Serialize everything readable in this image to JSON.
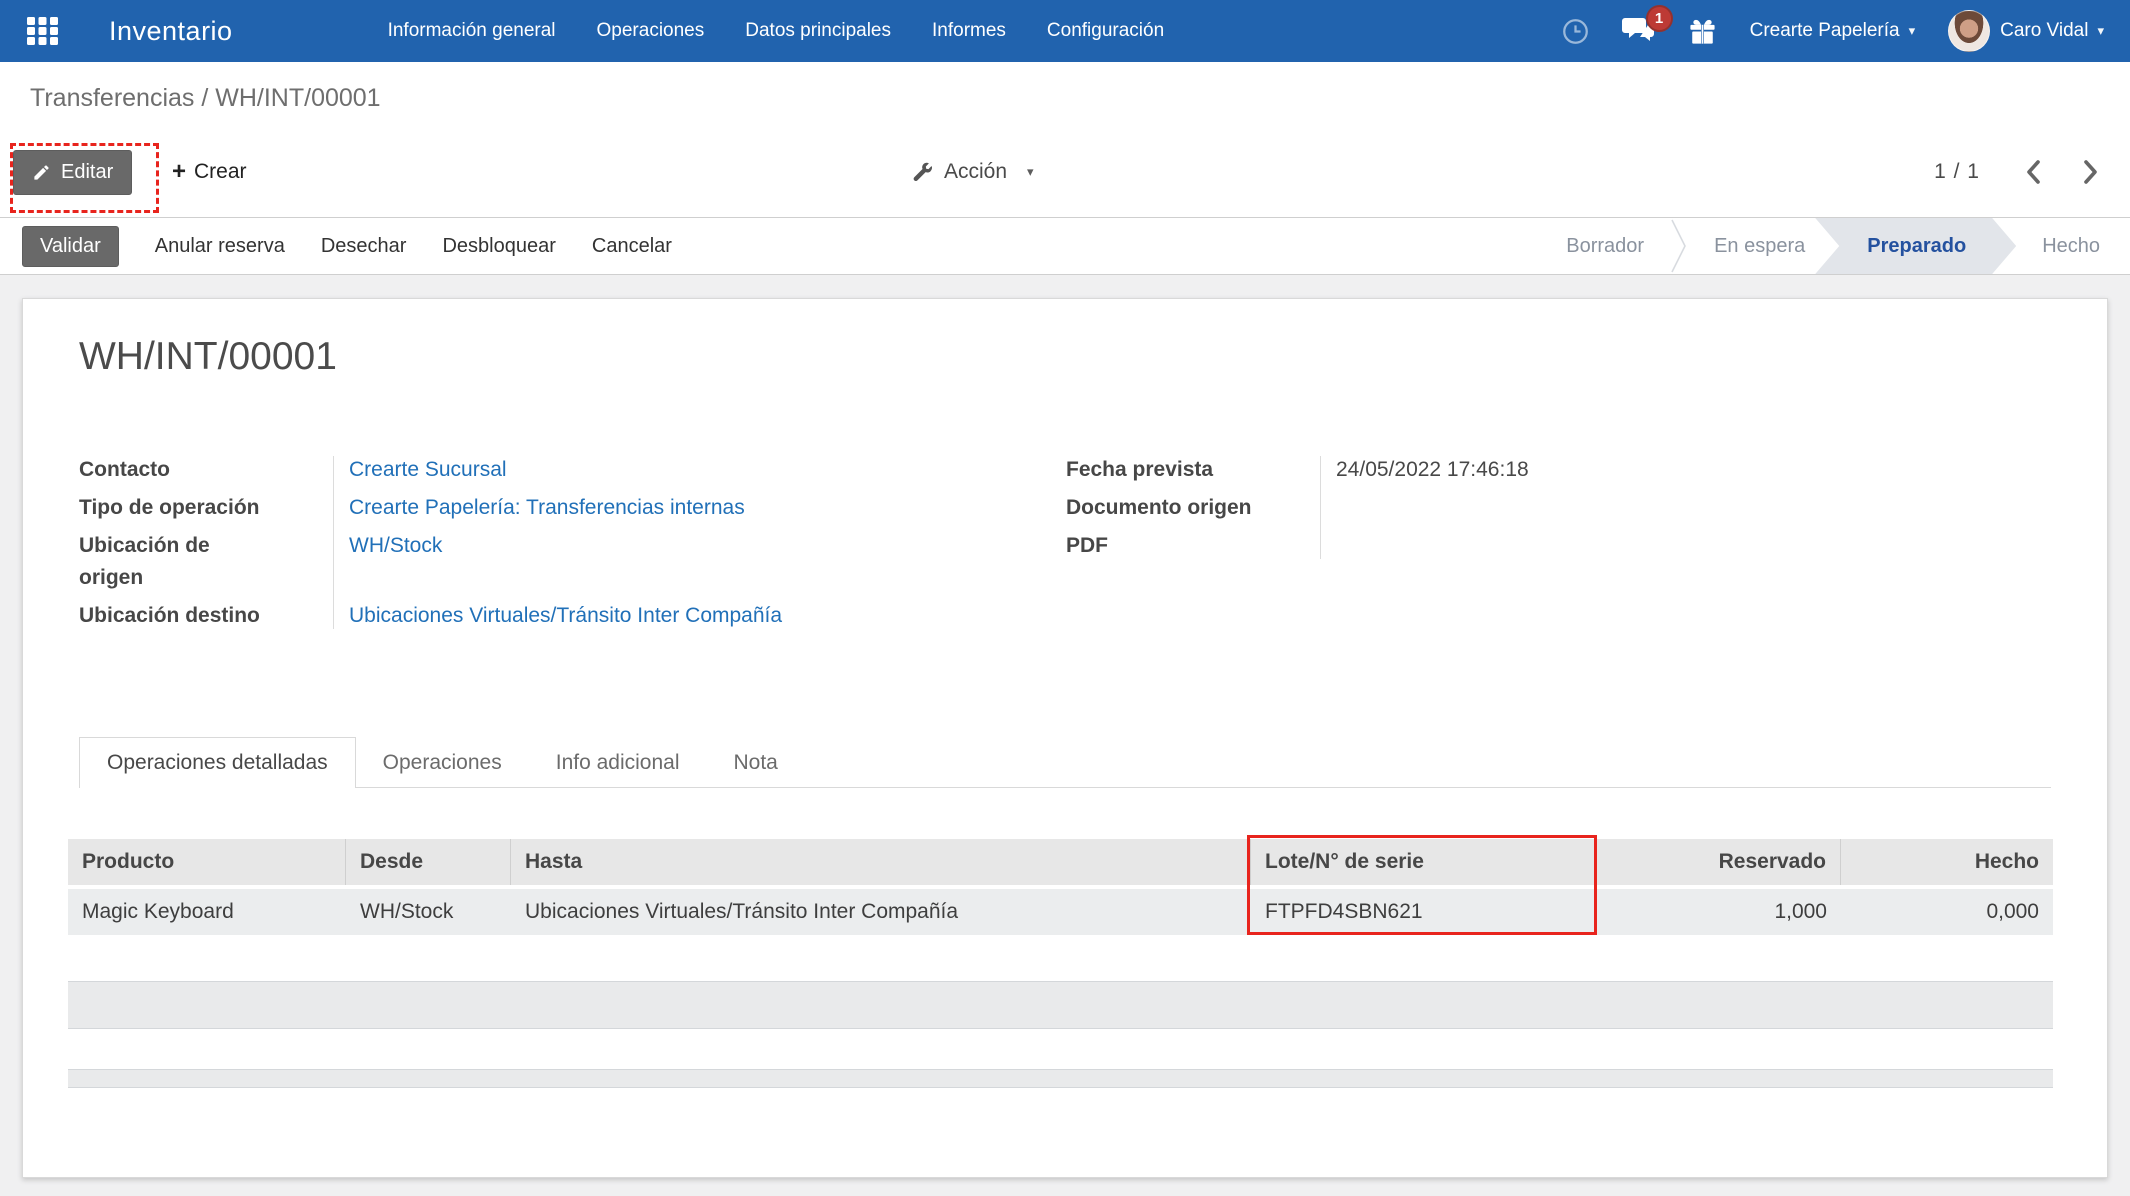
{
  "navbar": {
    "app_title": "Inventario",
    "menus": [
      "Información general",
      "Operaciones",
      "Datos principales",
      "Informes",
      "Configuración"
    ],
    "badge_count": "1",
    "company": "Crearte Papelería",
    "user": "Caro Vidal"
  },
  "breadcrumb": "Transferencias / WH/INT/00001",
  "actions": {
    "edit": "Editar",
    "create": "Crear",
    "action_menu": "Acción",
    "pager": "1 / 1"
  },
  "statusbar": {
    "buttons": [
      "Validar",
      "Anular reserva",
      "Desechar",
      "Desbloquear",
      "Cancelar"
    ],
    "stages": [
      "Borrador",
      "En espera",
      "Preparado",
      "Hecho"
    ],
    "active_stage": "Preparado"
  },
  "form": {
    "title": "WH/INT/00001",
    "left_fields": [
      {
        "label": "Contacto",
        "value": "Crearte Sucursal"
      },
      {
        "label": "Tipo de operación",
        "value": "Crearte Papelería: Transferencias internas"
      },
      {
        "label": "Ubicación de origen",
        "value": "WH/Stock"
      },
      {
        "label": "Ubicación destino",
        "value": "Ubicaciones Virtuales/Tránsito Inter Compañía"
      }
    ],
    "right_fields": [
      {
        "label": "Fecha prevista",
        "value": "24/05/2022 17:46:18"
      },
      {
        "label": "Documento origen",
        "value": ""
      },
      {
        "label": "PDF",
        "value": ""
      }
    ],
    "tabs": [
      "Operaciones detalladas",
      "Operaciones",
      "Info adicional",
      "Nota"
    ],
    "active_tab": "Operaciones detalladas"
  },
  "table": {
    "headers": [
      "Producto",
      "Desde",
      "Hasta",
      "Lote/N° de serie",
      "Reservado",
      "Hecho"
    ],
    "rows": [
      [
        "Magic Keyboard",
        "WH/Stock",
        "Ubicaciones Virtuales/Tránsito Inter Compañía",
        "FTPFD4SBN621",
        "1,000",
        "0,000"
      ]
    ]
  },
  "icons": {
    "apps_grid": "3x3-dots-grid",
    "clock": "activity-clock",
    "chat": "speech-bubbles",
    "gift": "gift-box",
    "caret": "▾",
    "pencil": "pencil",
    "plus": "+",
    "wrench": "wrench",
    "chevron_left": "‹",
    "chevron_right": "›"
  },
  "colors": {
    "navbar_bg": "#2163ae",
    "badge_red": "#bd3a35",
    "annotation_red": "#e8241d",
    "link_blue": "#2170b8",
    "active_stage_text": "#24519f",
    "active_stage_bg": "#e2e5ea",
    "dark_button": "#696969",
    "table_header_bg": "#e7e7e7",
    "table_row_bg": "#ebedee"
  }
}
